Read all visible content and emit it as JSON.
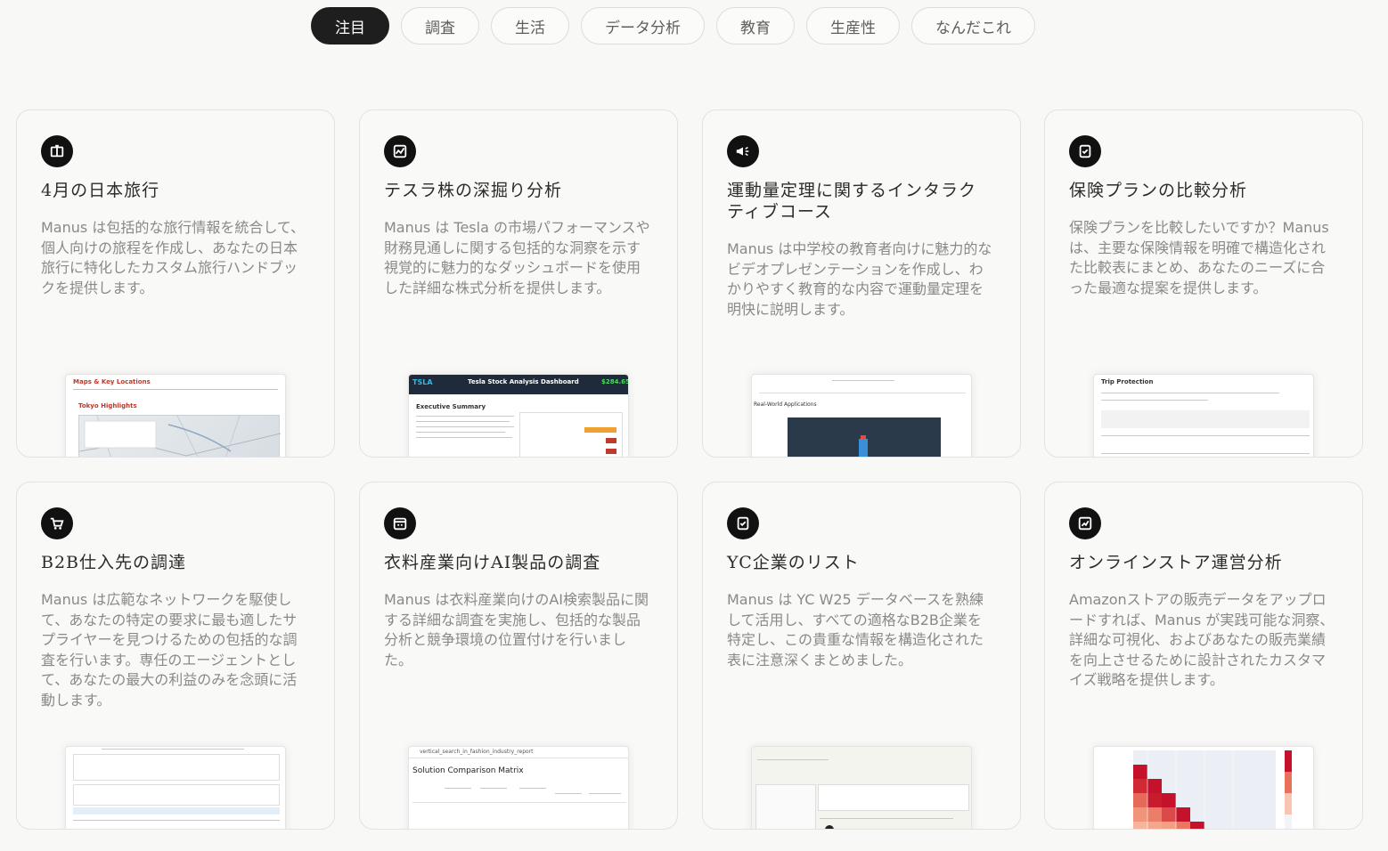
{
  "tabs": [
    "注目",
    "調査",
    "生活",
    "データ分析",
    "教育",
    "生産性",
    "なんだこれ"
  ],
  "cards": [
    {
      "title": "4月の日本旅行",
      "desc": "Manus は包括的な旅行情報を統合して、個人向けの旅程を作成し、あなたの日本旅行に特化したカスタム旅行ハンドブックを提供します。",
      "icon": "book-icon",
      "preview": {
        "heading": "Maps & Key Locations",
        "sub": "Tokyo Highlights"
      }
    },
    {
      "title": "テスラ株の深掘り分析",
      "desc": "Manus は Tesla の市場パフォーマンスや財務見通しに関する包括的な洞察を示す視覚的に魅力的なダッシュボードを使用した詳細な株式分析を提供します。",
      "icon": "chart-icon",
      "preview": {
        "ticker": "TSLA",
        "heading": "Tesla Stock Analysis Dashboard",
        "price": "$284.65",
        "sub": "Executive Summary"
      }
    },
    {
      "title": "運動量定理に関するインタラクティブコース",
      "desc": "Manus は中学校の教育者向けに魅力的なビデオプレゼンテーションを作成し、わかりやすく教育的な内容で運動量定理を明快に説明します。",
      "icon": "megaphone-icon",
      "preview": {
        "sub": "Real-World Applications"
      }
    },
    {
      "title": "保険プランの比較分析",
      "desc": "保険プランを比較したいですか？Manus は、主要な保険情報を明確で構造化された比較表にまとめ、あなたのニーズに合った最適な提案を提供します。",
      "icon": "clipboard-icon",
      "preview": {
        "heading": "Trip Protection"
      }
    },
    {
      "title": "B2B仕入先の調達",
      "desc": "Manus は広範なネットワークを駆使して、あなたの特定の要求に最も適したサプライヤーを見つけるための包括的な調査を行います。専任のエージェントとして、あなたの最大の利益のみを念頭に活動します。",
      "icon": "cart-icon",
      "preview": {}
    },
    {
      "title": "衣料産業向けAI製品の調査",
      "desc": "Manus は衣料産業向けのAI検索製品に関する詳細な調査を実施し、包括的な製品分析と競争環境の位置付けを行いました。",
      "icon": "calendar-icon",
      "preview": {
        "filename": "vertical_search_in_fashion_industry_report",
        "heading": "Solution Comparison Matrix"
      }
    },
    {
      "title": "YC企業のリスト",
      "desc": "Manus は YC W25 データベースを熟練して活用し、すべての適格なB2B企業を特定し、この貴重な情報を構造化された表に注意深くまとめました。",
      "icon": "clipboard-icon",
      "preview": {}
    },
    {
      "title": "オンラインストア運営分析",
      "desc": "Amazonストアの販売データをアップロードすれば、Manus が実践可能な洞察、詳細な可視化、およびあなたの販売業績を向上させるために設計されたカスタマイズ戦略を提供します。",
      "icon": "chart-up-icon",
      "preview": {}
    }
  ]
}
